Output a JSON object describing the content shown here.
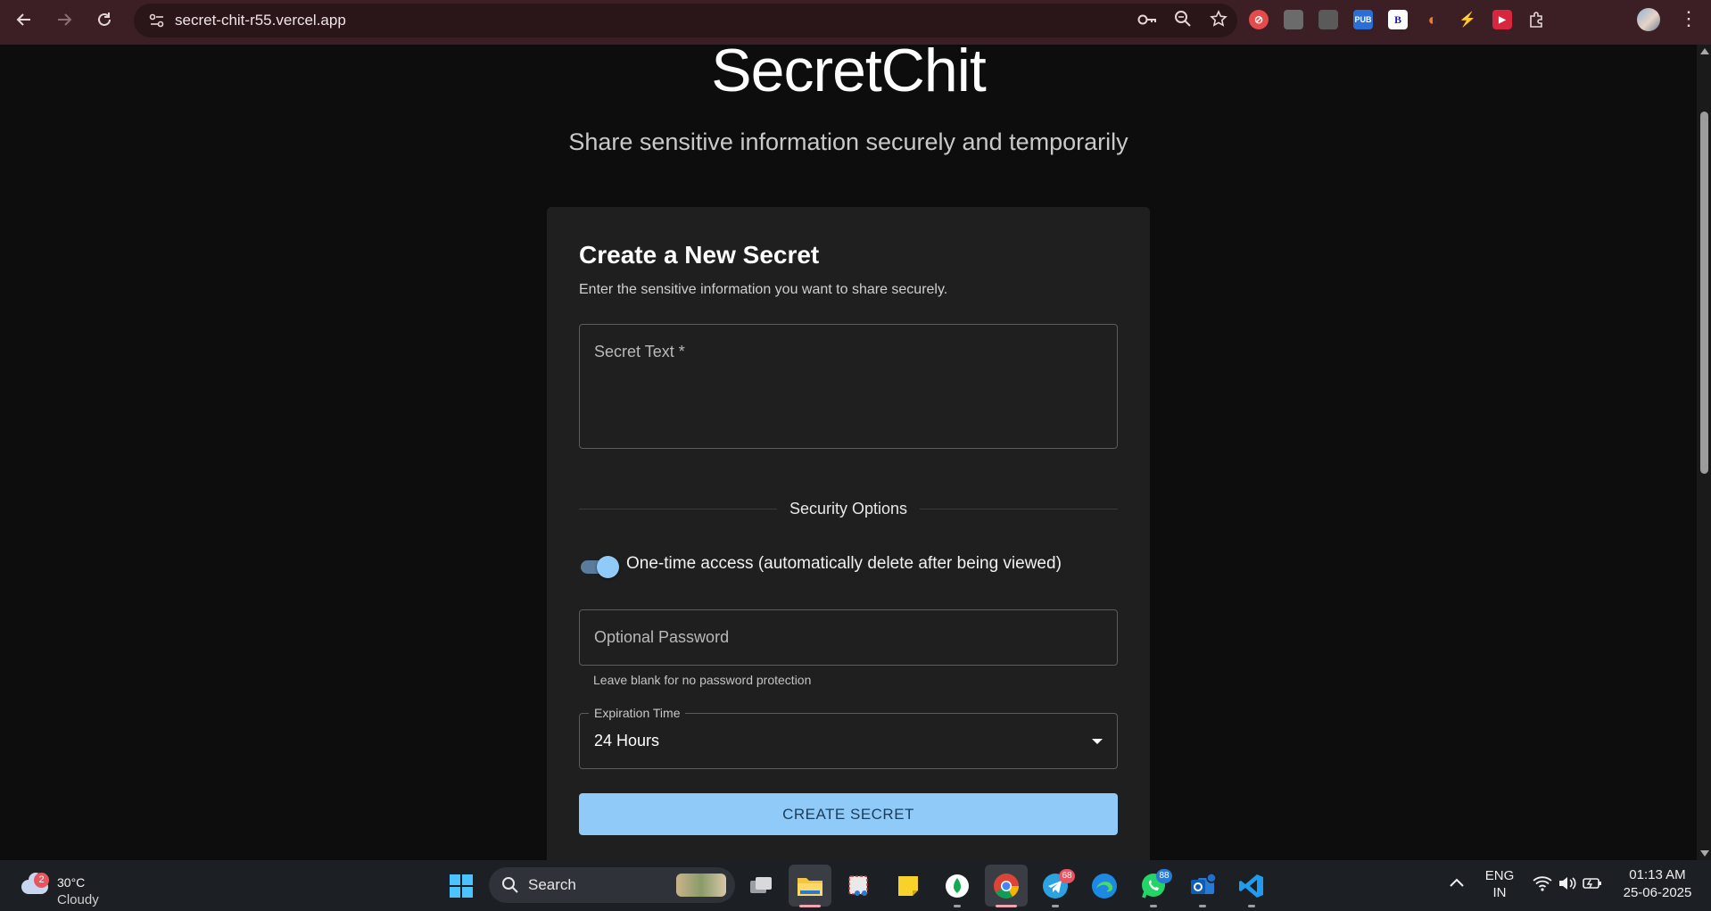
{
  "browser": {
    "url": "secret-chit-r55.vercel.app",
    "extensions": [
      {
        "name": "extension-red",
        "color": "#e54b4b",
        "glyph": "⊘"
      },
      {
        "name": "extension-grey-1",
        "color": "#6b6b6b",
        "glyph": ""
      },
      {
        "name": "extension-grey-2",
        "color": "#5a5a5a",
        "glyph": ""
      },
      {
        "name": "extension-pub",
        "color": "#2b6fd6",
        "glyph": "PUB"
      },
      {
        "name": "extension-b",
        "color": "#ffffff",
        "glyph": "B"
      },
      {
        "name": "extension-orange",
        "color": "#f27c1f",
        "glyph": "◐"
      },
      {
        "name": "extension-bolt",
        "color": "#3b1f24",
        "glyph": "⚡"
      },
      {
        "name": "extension-red-play",
        "color": "#d7263d",
        "glyph": "▶"
      }
    ]
  },
  "page": {
    "title": "SecretChit",
    "subtitle": "Share sensitive information securely and temporarily"
  },
  "form": {
    "heading": "Create a New Secret",
    "description": "Enter the sensitive information you want to share securely.",
    "secret_label": "Secret Text *",
    "security_heading": "Security Options",
    "one_time_label": "One-time access (automatically delete after being viewed)",
    "one_time_enabled": true,
    "password_placeholder": "Optional Password",
    "password_helper": "Leave blank for no password protection",
    "expiration_label": "Expiration Time",
    "expiration_value": "24 Hours",
    "submit_label": "CREATE SECRET"
  },
  "colors": {
    "accent": "#90caf9",
    "card_bg": "#1f1f1f",
    "page_bg": "#0d0d0d",
    "browser_bar": "#3b1f24"
  },
  "taskbar": {
    "weather_badge": "2",
    "weather_temp": "30°C",
    "weather_condition": "Cloudy",
    "search_label": "Search",
    "telegram_badge": "68",
    "whatsapp_badge": "88",
    "language_top": "ENG",
    "language_bottom": "IN",
    "time": "01:13 AM",
    "date": "25-06-2025"
  }
}
